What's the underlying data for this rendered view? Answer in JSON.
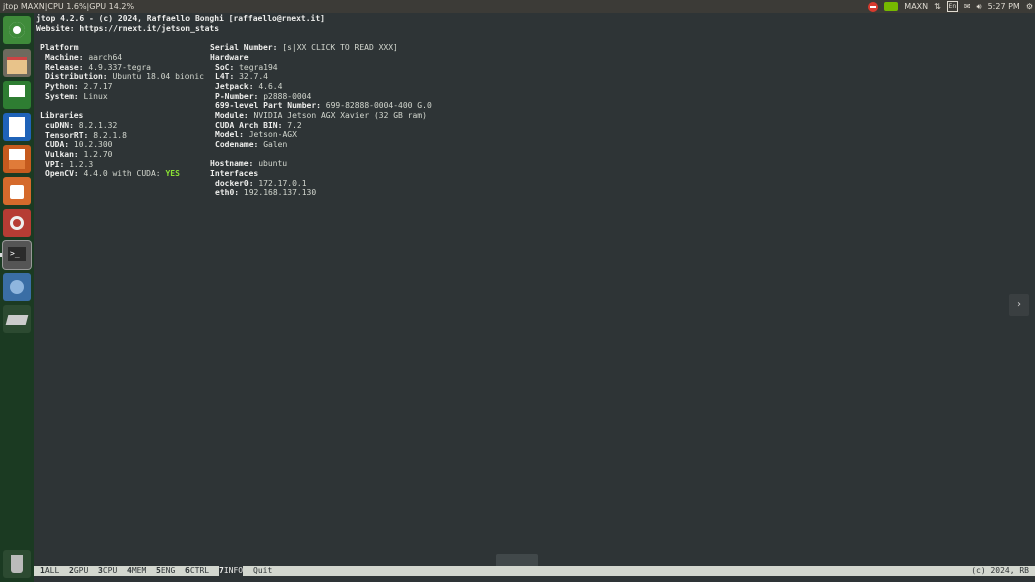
{
  "topbar": {
    "window_title": "jtop MAXN|CPU 1.6%|GPU 14.2%",
    "power_mode": "MAXN",
    "keyboard": "En",
    "time": "5:27 PM"
  },
  "header": {
    "line1": "jtop 4.2.6 - (c) 2024, Raffaello Bonghi [raffaello@rnext.it]",
    "line2": "Website: https://rnext.it/jetson_stats"
  },
  "platform": {
    "title": "Platform",
    "rows": [
      {
        "k": "Machine:",
        "v": "aarch64"
      },
      {
        "k": "Release:",
        "v": "4.9.337-tegra"
      },
      {
        "k": "Distribution:",
        "v": "Ubuntu 18.04 bionic"
      },
      {
        "k": "Python:",
        "v": "2.7.17"
      },
      {
        "k": "System:",
        "v": "Linux"
      }
    ]
  },
  "libraries": {
    "title": "Libraries",
    "rows": [
      {
        "k": "cuDNN:",
        "v": "8.2.1.32"
      },
      {
        "k": "TensorRT:",
        "v": "8.2.1.8"
      },
      {
        "k": "CUDA:",
        "v": "10.2.300"
      },
      {
        "k": "Vulkan:",
        "v": "1.2.70"
      },
      {
        "k": "VPI:",
        "v": "1.2.3"
      },
      {
        "k": "OpenCV:",
        "v": "4.4.0 with CUDA:",
        "extra": "YES"
      }
    ]
  },
  "serial": {
    "k": "Serial Number:",
    "v": "[s|XX CLICK TO READ XXX]"
  },
  "hardware": {
    "title": "Hardware",
    "rows": [
      {
        "k": "SoC:",
        "v": "tegra194"
      },
      {
        "k": "L4T:",
        "v": "32.7.4"
      },
      {
        "k": "Jetpack:",
        "v": "4.6.4"
      },
      {
        "k": "P-Number:",
        "v": "p2888-0004"
      },
      {
        "k": "699-level Part Number:",
        "v": "699-82888-0004-400 G.0"
      },
      {
        "k": "Module:",
        "v": "NVIDIA Jetson AGX Xavier (32 GB ram)"
      },
      {
        "k": "CUDA Arch BIN:",
        "v": "7.2"
      },
      {
        "k": "Model:",
        "v": "Jetson-AGX"
      },
      {
        "k": "Codename:",
        "v": "Galen"
      }
    ]
  },
  "hostname": {
    "k": "Hostname:",
    "v": "ubuntu"
  },
  "interfaces": {
    "title": "Interfaces",
    "rows": [
      {
        "k": "docker0:",
        "v": "172.17.0.1"
      },
      {
        "k": "eth0:",
        "v": "192.168.137.130"
      }
    ]
  },
  "menu": {
    "items": [
      {
        "n": "1",
        "l": "ALL"
      },
      {
        "n": "2",
        "l": "GPU"
      },
      {
        "n": "3",
        "l": "CPU"
      },
      {
        "n": "4",
        "l": "MEM"
      },
      {
        "n": "5",
        "l": "ENG"
      },
      {
        "n": "6",
        "l": "CTRL"
      },
      {
        "n": "7",
        "l": "INFO"
      }
    ],
    "quit": "Quit",
    "copyright": "(c) 2024, RB"
  }
}
